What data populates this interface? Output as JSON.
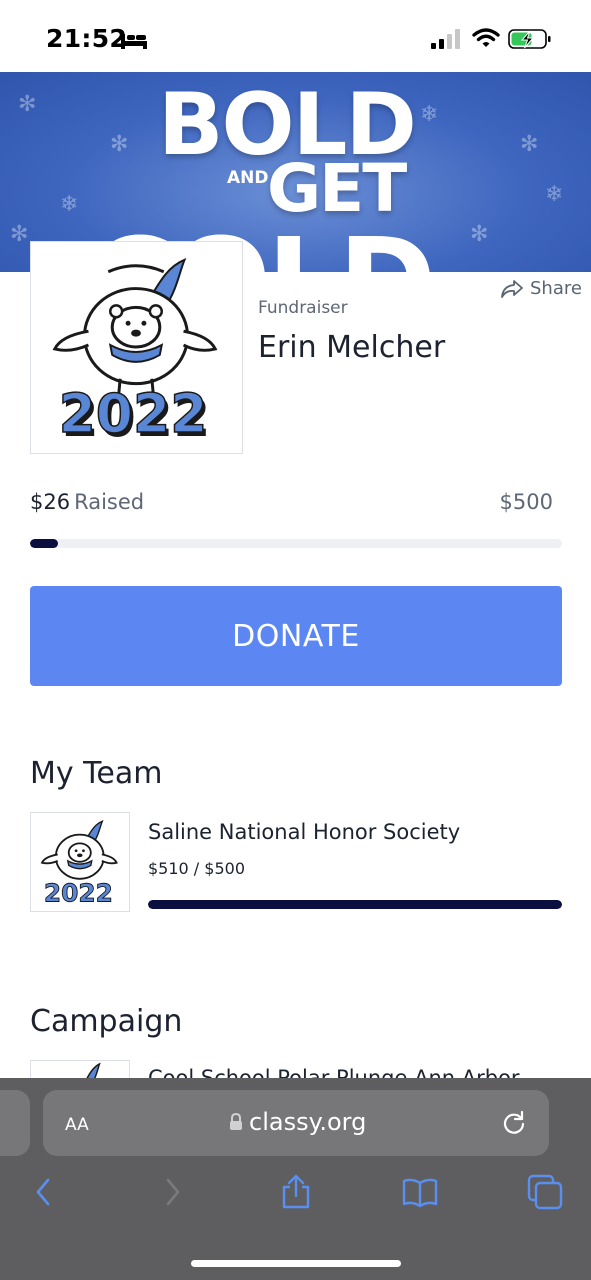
{
  "status_bar": {
    "time": "21:52"
  },
  "banner": {
    "line1": "BOLD",
    "and": "AND",
    "line2": "GET",
    "line3": "COLD"
  },
  "avatar": {
    "year": "2022"
  },
  "share": {
    "label": "Share"
  },
  "fundraiser": {
    "label": "Fundraiser",
    "name": "Erin Melcher"
  },
  "progress": {
    "raised_amount": "$26",
    "raised_label": "Raised",
    "goal": "$500",
    "fraction": 0.052
  },
  "donate": {
    "label": "DONATE"
  },
  "team_section": {
    "title": "My Team",
    "team": {
      "name": "Saline National Honor Society",
      "progress_text": "$510 / $500",
      "fraction": 1.0
    }
  },
  "campaign_section": {
    "title": "Campaign",
    "campaign_name": "Cool School Polar Plunge Ann Arbor"
  },
  "browser": {
    "aa_label": "AA",
    "url": "classy.org"
  },
  "colors": {
    "accent": "#5c87f3",
    "progress": "#0b0f3f",
    "banner": "#3f66bf",
    "toolbar_icon": "#5a8ff0"
  }
}
